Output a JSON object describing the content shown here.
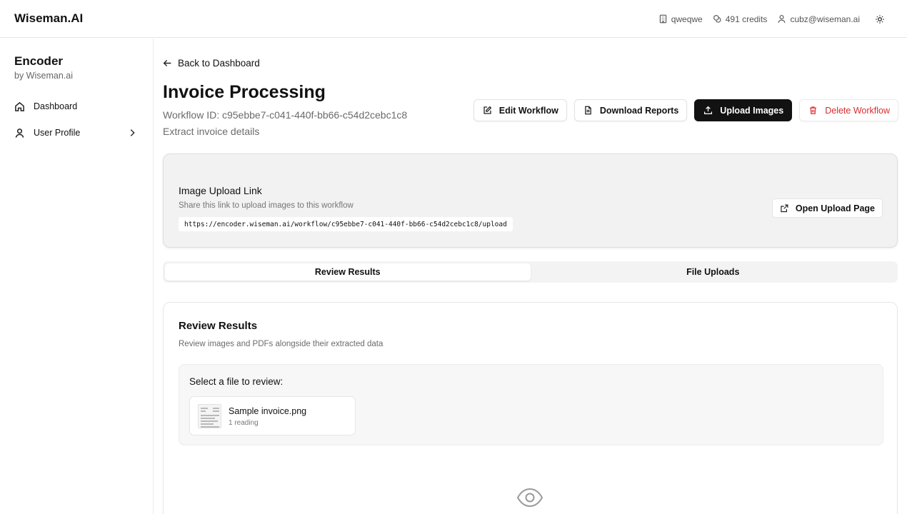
{
  "brand": "Wiseman.AI",
  "topbar": {
    "org": "qweqwe",
    "credits": "491 credits",
    "email": "cubz@wiseman.ai",
    "icons": [
      "building-icon",
      "coins-icon",
      "user-icon",
      "sun-icon"
    ]
  },
  "sidebar": {
    "app_name": "Encoder",
    "app_sub": "by Wiseman.ai",
    "items": [
      {
        "label": "Dashboard",
        "icon": "home-icon"
      },
      {
        "label": "User Profile",
        "icon": "user-icon"
      }
    ]
  },
  "main": {
    "back_label": "Back to Dashboard",
    "title": "Invoice Processing",
    "workflow_id": "Workflow ID: c95ebbe7-c041-440f-bb66-c54d2cebc1c8",
    "description": "Extract invoice details",
    "actions": {
      "edit": "Edit Workflow",
      "download": "Download Reports",
      "upload": "Upload Images",
      "delete": "Delete Workflow"
    }
  },
  "upload_link": {
    "title": "Image Upload Link",
    "subtitle": "Share this link to upload images to this workflow",
    "url": "https://encoder.wiseman.ai/workflow/c95ebbe7-c041-440f-bb66-c54d2cebc1c8/upload",
    "open_label": "Open Upload Page"
  },
  "tabs": [
    {
      "label": "Review Results",
      "active": true
    },
    {
      "label": "File Uploads",
      "active": false
    }
  ],
  "review": {
    "title": "Review Results",
    "subtitle": "Review images and PDFs alongside their extracted data",
    "select_label": "Select a file to review:",
    "files": [
      {
        "name": "Sample invoice.png",
        "meta": "1 reading"
      }
    ]
  },
  "colors": {
    "accent_dark": "#121212",
    "danger": "#d92d2d",
    "muted_text": "#6b6b6b",
    "card_bg": "#f2f2f2"
  }
}
